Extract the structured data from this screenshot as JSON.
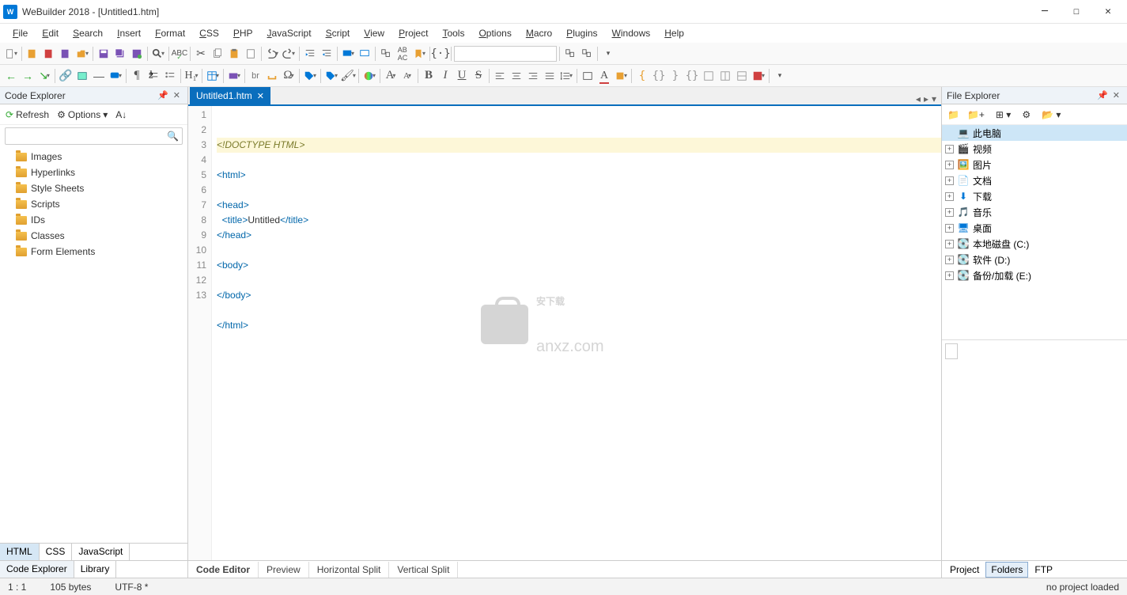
{
  "title": "WeBuilder 2018 - [Untitled1.htm]",
  "menu": [
    "File",
    "Edit",
    "Search",
    "Insert",
    "Format",
    "CSS",
    "PHP",
    "JavaScript",
    "Script",
    "View",
    "Project",
    "Tools",
    "Options",
    "Macro",
    "Plugins",
    "Windows",
    "Help"
  ],
  "left_panel": {
    "title": "Code Explorer",
    "refresh": "Refresh",
    "options": "Options",
    "items": [
      "Images",
      "Hyperlinks",
      "Style Sheets",
      "Scripts",
      "IDs",
      "Classes",
      "Form Elements"
    ],
    "lang_tabs": [
      "HTML",
      "CSS",
      "JavaScript"
    ],
    "bottom_tabs": [
      "Code Explorer",
      "Library"
    ]
  },
  "file_tab": "Untitled1.htm",
  "code_lines": [
    {
      "n": 1,
      "html": "<span class='t-doctype'>&lt;!DOCTYPE HTML&gt;</span>",
      "hl": true
    },
    {
      "n": 2,
      "html": ""
    },
    {
      "n": 3,
      "html": "<span class='t-tag'>&lt;html&gt;</span>"
    },
    {
      "n": 4,
      "html": ""
    },
    {
      "n": 5,
      "html": "<span class='t-tag'>&lt;head&gt;</span>"
    },
    {
      "n": 6,
      "html": "  <span class='t-tag'>&lt;title&gt;</span><span class='t-text'>Untitled</span><span class='t-tag'>&lt;/title&gt;</span>"
    },
    {
      "n": 7,
      "html": "<span class='t-tag'>&lt;/head&gt;</span>"
    },
    {
      "n": 8,
      "html": ""
    },
    {
      "n": 9,
      "html": "<span class='t-tag'>&lt;body&gt;</span>"
    },
    {
      "n": 10,
      "html": ""
    },
    {
      "n": 11,
      "html": "<span class='t-tag'>&lt;/body&gt;</span>"
    },
    {
      "n": 12,
      "html": ""
    },
    {
      "n": 13,
      "html": "<span class='t-tag'>&lt;/html&gt;</span>"
    }
  ],
  "center_tabs": [
    "Code Editor",
    "Preview",
    "Horizontal Split",
    "Vertical Split"
  ],
  "right_panel": {
    "title": "File Explorer",
    "items": [
      {
        "label": "此电脑",
        "icon": "💻",
        "root": true
      },
      {
        "label": "视频",
        "icon": "🎬",
        "exp": true
      },
      {
        "label": "图片",
        "icon": "🖼️",
        "exp": true
      },
      {
        "label": "文档",
        "icon": "📄",
        "exp": true
      },
      {
        "label": "下载",
        "icon": "⬇",
        "exp": true,
        "color": "#0078d7"
      },
      {
        "label": "音乐",
        "icon": "🎵",
        "exp": true
      },
      {
        "label": "桌面",
        "icon": "🖥",
        "exp": true,
        "color": "#0078d7"
      },
      {
        "label": "本地磁盘 (C:)",
        "icon": "💽",
        "exp": true
      },
      {
        "label": "软件 (D:)",
        "icon": "💽",
        "exp": true
      },
      {
        "label": "备份/加载 (E:)",
        "icon": "💽",
        "exp": true
      }
    ],
    "bottom_tabs": [
      "Project",
      "Folders",
      "FTP"
    ]
  },
  "status": {
    "pos": "1 : 1",
    "size": "105 bytes",
    "enc": "UTF-8 *",
    "proj": "no project loaded"
  },
  "watermark": "安下载",
  "watermark_sub": "anxz.com"
}
